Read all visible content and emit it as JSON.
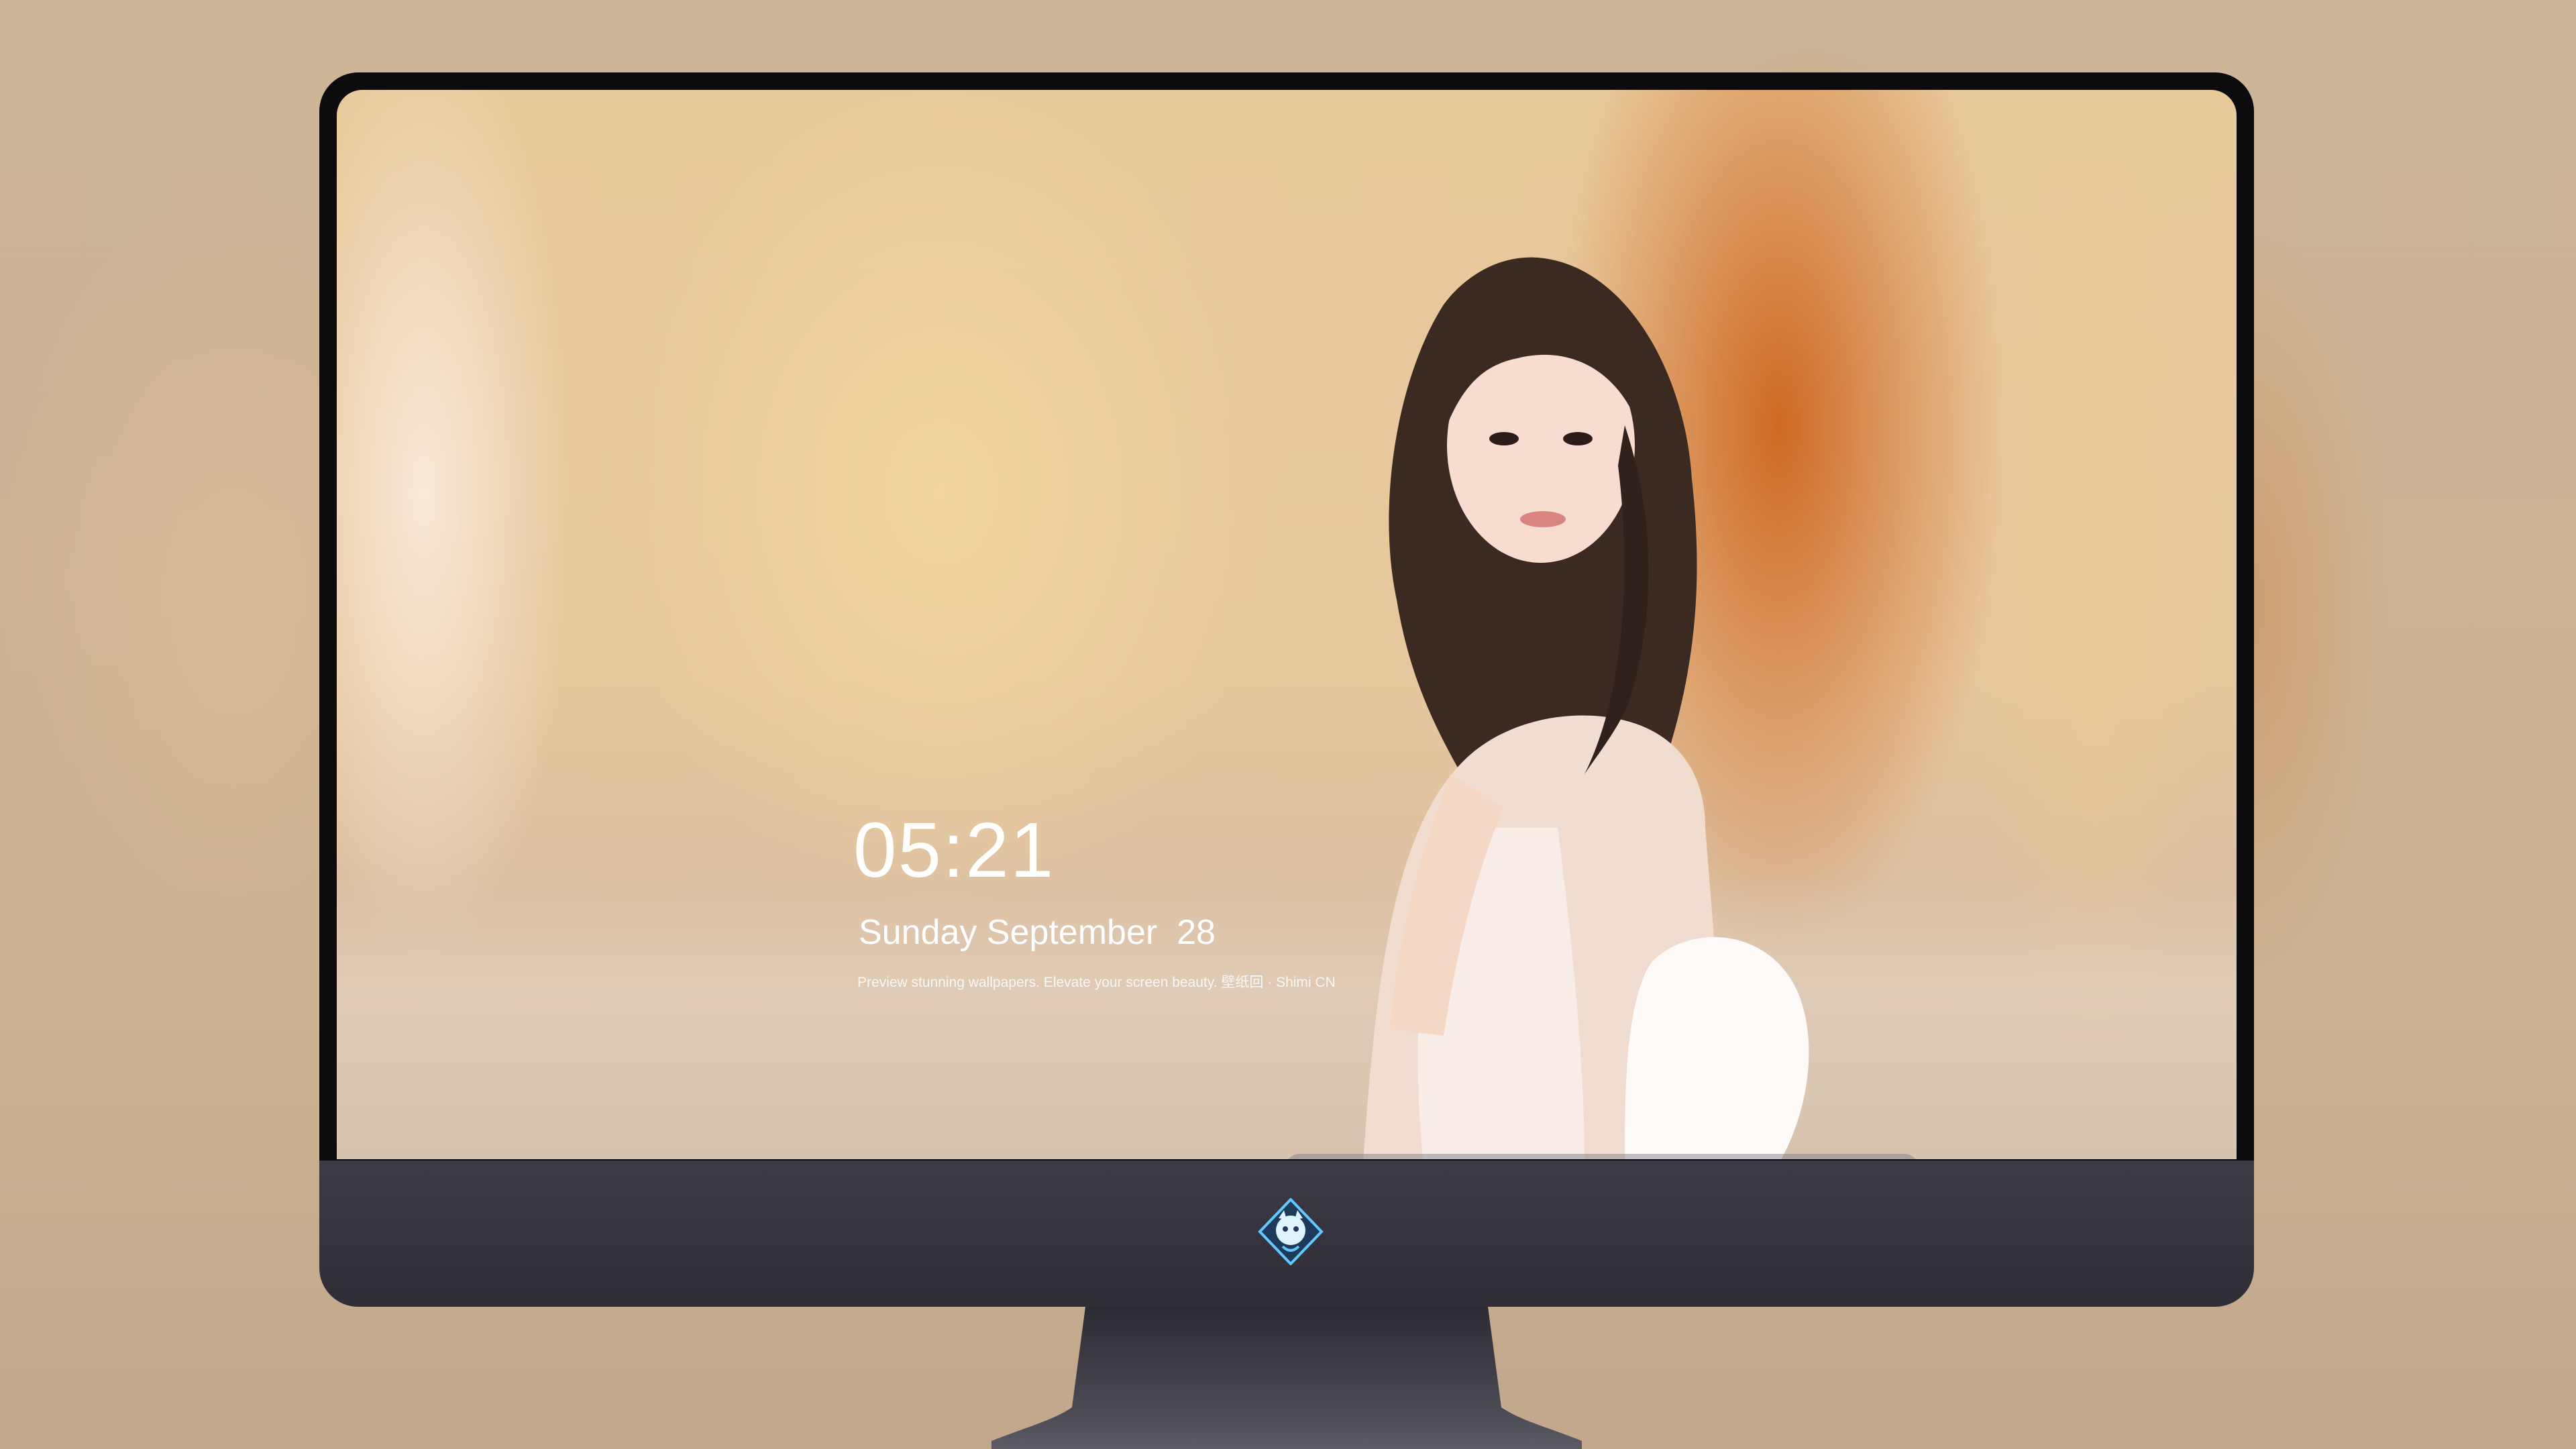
{
  "lockscreen": {
    "time": "05:21",
    "date": "Sunday September  28",
    "tagline": "Preview stunning wallpapers. Elevate your screen beauty. 壁纸回 · Shimi CN"
  },
  "dock": {
    "items": [
      {
        "name": "messages-icon",
        "color": "#35c84a"
      },
      {
        "name": "weather-icon",
        "color": "#2f8cf0"
      },
      {
        "name": "clock-icon",
        "color": "#1a1a1a"
      },
      {
        "name": "preview-icon",
        "color": "#e8c24a"
      },
      {
        "name": "clips-icon",
        "color": "#3ab3e6"
      },
      {
        "name": "notes-icon",
        "color": "#f7d24a"
      },
      {
        "name": "photo-booth-icon",
        "color": "#f0f0f0"
      },
      {
        "name": "music-icon",
        "color": "#e14be8"
      },
      {
        "name": "app-store-icon",
        "color": "#1f8cf5"
      },
      {
        "name": "camera-icon",
        "color": "#5a5a62"
      }
    ]
  }
}
